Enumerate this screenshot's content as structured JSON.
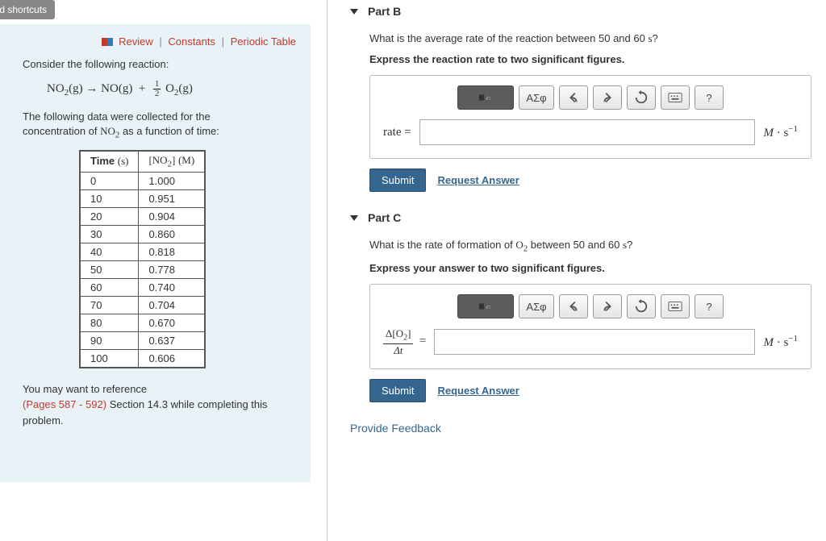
{
  "keyboard_shortcuts": "oard shortcuts",
  "left": {
    "links": {
      "review": "Review",
      "constants": "Constants",
      "periodic": "Periodic Table"
    },
    "intro": "Consider the following reaction:",
    "equation": {
      "lhs": "NO",
      "lhs_sub": "2",
      "lhs_state": "(g)",
      "arrow": "→",
      "rhs1": "NO",
      "rhs1_state": "(g)",
      "plus": "+",
      "frac_num": "1",
      "frac_den": "2",
      "rhs2": "O",
      "rhs2_sub": "2",
      "rhs2_state": "(g)"
    },
    "desc1": "The following data were collected for the",
    "desc2a": "concentration of ",
    "desc2b_chem": "NO",
    "desc2b_sub": "2",
    "desc2c": " as a function of time:",
    "table": {
      "head_time": "Time",
      "head_time_unit": "(s)",
      "head_conc_open": "[NO",
      "head_conc_sub": "2",
      "head_conc_close": "]",
      "head_conc_unit": "(M)",
      "rows": [
        {
          "t": "0",
          "c": "1.000"
        },
        {
          "t": "10",
          "c": "0.951"
        },
        {
          "t": "20",
          "c": "0.904"
        },
        {
          "t": "30",
          "c": "0.860"
        },
        {
          "t": "40",
          "c": "0.818"
        },
        {
          "t": "50",
          "c": "0.778"
        },
        {
          "t": "60",
          "c": "0.740"
        },
        {
          "t": "70",
          "c": "0.704"
        },
        {
          "t": "80",
          "c": "0.670"
        },
        {
          "t": "90",
          "c": "0.637"
        },
        {
          "t": "100",
          "c": "0.606"
        }
      ]
    },
    "ref1": "You may want to reference",
    "ref2_pages": "(Pages 587 - 592)",
    "ref2_rest": " Section 14.3 while completing this problem."
  },
  "partB": {
    "title": "Part B",
    "prompt1a": "What is the average rate of the reaction between 50 and 60 ",
    "prompt1b_unit": "s",
    "prompt1c": "?",
    "prompt2": "Express the reaction rate to two significant figures.",
    "rate_label": "rate =",
    "units_M": "M",
    "units_dot": "·",
    "units_s": "s",
    "units_exp": "−1",
    "submit": "Submit",
    "request": "Request Answer"
  },
  "partC": {
    "title": "Part C",
    "prompt1a": "What is the rate of formation of ",
    "prompt1b_chem": "O",
    "prompt1b_sub": "2",
    "prompt1c": " between 50 and 60 ",
    "prompt1d_unit": "s",
    "prompt1e": "?",
    "prompt2": "Express your answer to two significant figures.",
    "frac_top1": "Δ[O",
    "frac_top_sub": "2",
    "frac_top2": "]",
    "frac_bot": "Δt",
    "eq": "=",
    "submit": "Submit",
    "request": "Request Answer"
  },
  "toolbar": {
    "greek": "ΑΣφ",
    "help": "?"
  },
  "feedback": "Provide Feedback"
}
